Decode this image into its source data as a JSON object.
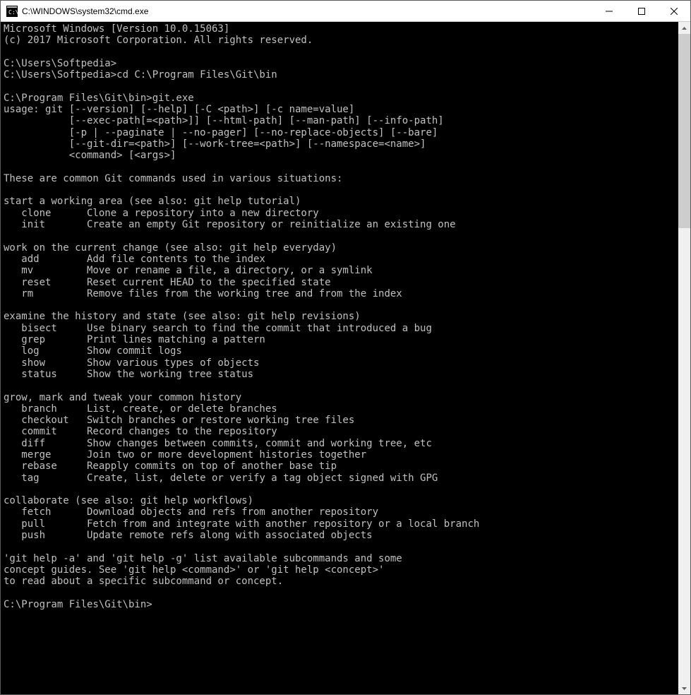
{
  "titlebar": {
    "title": "C:\\WINDOWS\\system32\\cmd.exe"
  },
  "terminal": {
    "header": [
      "Microsoft Windows [Version 10.0.15063]",
      "(c) 2017 Microsoft Corporation. All rights reserved.",
      "",
      "C:\\Users\\Softpedia>",
      "C:\\Users\\Softpedia>cd C:\\Program Files\\Git\\bin",
      "",
      "C:\\Program Files\\Git\\bin>git.exe"
    ],
    "usage": [
      "usage: git [--version] [--help] [-C <path>] [-c name=value]",
      "           [--exec-path[=<path>]] [--html-path] [--man-path] [--info-path]",
      "           [-p | --paginate | --no-pager] [--no-replace-objects] [--bare]",
      "           [--git-dir=<path>] [--work-tree=<path>] [--namespace=<name>]",
      "           <command> [<args>]"
    ],
    "intro": "These are common Git commands used in various situations:",
    "sections": [
      {
        "title": "start a working area (see also: git help tutorial)",
        "items": [
          {
            "cmd": "clone",
            "desc": "Clone a repository into a new directory"
          },
          {
            "cmd": "init",
            "desc": "Create an empty Git repository or reinitialize an existing one"
          }
        ]
      },
      {
        "title": "work on the current change (see also: git help everyday)",
        "items": [
          {
            "cmd": "add",
            "desc": "Add file contents to the index"
          },
          {
            "cmd": "mv",
            "desc": "Move or rename a file, a directory, or a symlink"
          },
          {
            "cmd": "reset",
            "desc": "Reset current HEAD to the specified state"
          },
          {
            "cmd": "rm",
            "desc": "Remove files from the working tree and from the index"
          }
        ]
      },
      {
        "title": "examine the history and state (see also: git help revisions)",
        "items": [
          {
            "cmd": "bisect",
            "desc": "Use binary search to find the commit that introduced a bug"
          },
          {
            "cmd": "grep",
            "desc": "Print lines matching a pattern"
          },
          {
            "cmd": "log",
            "desc": "Show commit logs"
          },
          {
            "cmd": "show",
            "desc": "Show various types of objects"
          },
          {
            "cmd": "status",
            "desc": "Show the working tree status"
          }
        ]
      },
      {
        "title": "grow, mark and tweak your common history",
        "items": [
          {
            "cmd": "branch",
            "desc": "List, create, or delete branches"
          },
          {
            "cmd": "checkout",
            "desc": "Switch branches or restore working tree files"
          },
          {
            "cmd": "commit",
            "desc": "Record changes to the repository"
          },
          {
            "cmd": "diff",
            "desc": "Show changes between commits, commit and working tree, etc"
          },
          {
            "cmd": "merge",
            "desc": "Join two or more development histories together"
          },
          {
            "cmd": "rebase",
            "desc": "Reapply commits on top of another base tip"
          },
          {
            "cmd": "tag",
            "desc": "Create, list, delete or verify a tag object signed with GPG"
          }
        ]
      },
      {
        "title": "collaborate (see also: git help workflows)",
        "items": [
          {
            "cmd": "fetch",
            "desc": "Download objects and refs from another repository"
          },
          {
            "cmd": "pull",
            "desc": "Fetch from and integrate with another repository or a local branch"
          },
          {
            "cmd": "push",
            "desc": "Update remote refs along with associated objects"
          }
        ]
      }
    ],
    "footer": [
      "'git help -a' and 'git help -g' list available subcommands and some",
      "concept guides. See 'git help <command>' or 'git help <concept>'",
      "to read about a specific subcommand or concept."
    ],
    "prompt": "C:\\Program Files\\Git\\bin>"
  }
}
